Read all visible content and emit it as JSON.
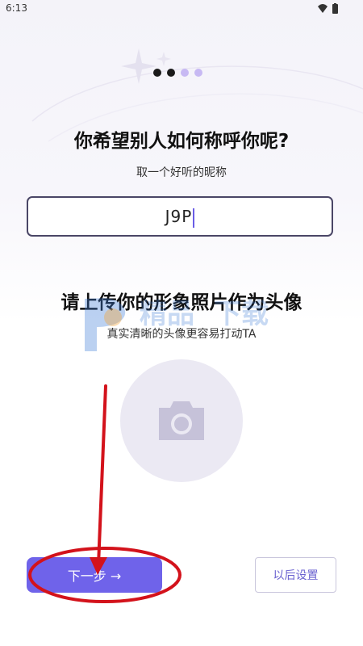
{
  "status_bar": {
    "time": "6:13",
    "icons": [
      "wifi-icon",
      "battery-icon"
    ]
  },
  "onboarding": {
    "total_steps": 4,
    "current_step": 2
  },
  "nickname_section": {
    "title": "你希望别人如何称呼你呢?",
    "subtitle": "取一个好听的昵称",
    "input_value": "J9P"
  },
  "avatar_section": {
    "title": "请上传你的形象照片作为头像",
    "subtitle": "真实清晰的头像更容易打动TA",
    "upload_icon": "camera-icon"
  },
  "actions": {
    "next_label": "下一步 →",
    "later_label": "以后设置"
  },
  "colors": {
    "accent": "#6f63ea",
    "dot_active": "#1a1a1a",
    "dot_inactive": "#c7b9f3",
    "annotation_red": "#d3121b"
  }
}
